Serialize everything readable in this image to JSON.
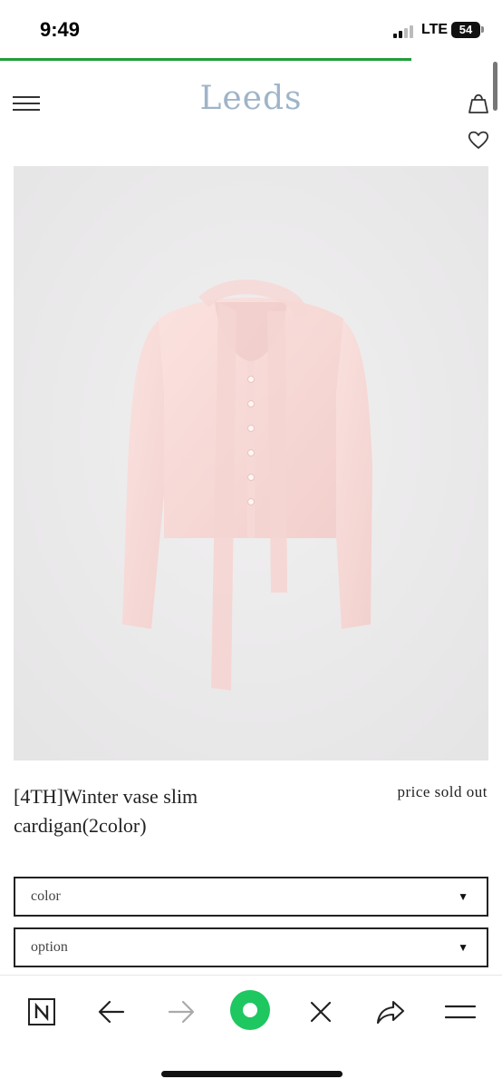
{
  "status_bar": {
    "time": "9:49",
    "network": "LTE",
    "battery": "54"
  },
  "page_load_progress": 0.82,
  "header": {
    "logo": "Leeds",
    "menu_icon": "hamburger-menu-icon",
    "bag_icon": "shopping-bag-icon",
    "wishlist_icon": "heart-icon"
  },
  "product": {
    "image_alt": "pink fuzzy cardigan with scarf tie",
    "name": "[4TH]Winter vase slim cardigan(2color)",
    "price": "price sold out",
    "options": [
      {
        "label": "color"
      },
      {
        "label": "option"
      }
    ]
  },
  "browser_toolbar": {
    "items": [
      "naver-n-icon",
      "back-arrow-icon",
      "forward-arrow-icon",
      "green-dot-icon",
      "close-icon",
      "share-icon",
      "menu-icon"
    ]
  },
  "colors": {
    "progress": "#1f9e3a",
    "logo": "#9fb4c8",
    "garment": "#f7d6d4",
    "image_bg": "#ecebec",
    "accent_green": "#1ec760"
  }
}
